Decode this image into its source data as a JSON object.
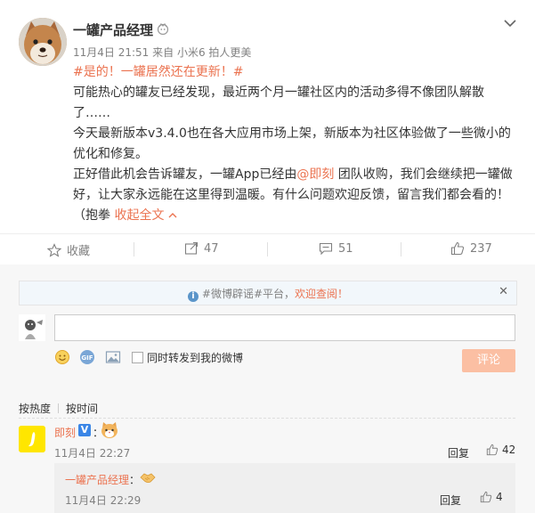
{
  "post": {
    "author": "一罐产品经理",
    "time": "11月4日 21:51",
    "source_prefix": "来自",
    "source": "小米6 拍人更美",
    "hashtag": "#是的！一罐居然还在更新！#",
    "paragraph1": "可能热心的罐友已经发现，最近两个月一罐社区内的活动多得不像团队解散了……",
    "paragraph2": "今天最新版本v3.4.0也在各大应用市场上架，新版本为社区体验做了一些微小的优化和修复。",
    "paragraph3_before": "正好借此机会告诉罐友，一罐App已经由",
    "paragraph3_mention": "@即刻",
    "paragraph3_after": " 团队收购，我们会继续把一罐做好，让大家永远能在这里得到温暖。有什么问题欢迎反馈，留言我们都会看的！（抱拳",
    "collapse_label": "收起全文",
    "collapse_icon": "chevron-up-icon"
  },
  "actions": {
    "favorite_label": "收藏",
    "repost_count": "47",
    "comment_count": "51",
    "like_count": "237"
  },
  "comment_box": {
    "notice_prefix": "#微博辟谣#平台，",
    "notice_link": "欢迎查阅！",
    "repost_checkbox_label": "同时转发到我的微博",
    "submit_label": "评论"
  },
  "sort_tabs": {
    "hot": "按热度",
    "time": "按时间"
  },
  "comments": [
    {
      "name": "即刻",
      "colon": "：",
      "time": "11月4日 22:27",
      "reply_label": "回复",
      "likes": "42",
      "emoji": "cat-emoji"
    }
  ],
  "replies": [
    {
      "name": "一罐产品经理",
      "colon": "：",
      "time": "11月4日 22:29",
      "reply_label": "回复",
      "likes": "4",
      "emoji": "handshake-emoji"
    }
  ],
  "colors": {
    "accent": "#eb7350",
    "submit_disabled": "#fbbfa3",
    "verified_blue": "#3b86e6",
    "jike_yellow": "#ffe600"
  }
}
